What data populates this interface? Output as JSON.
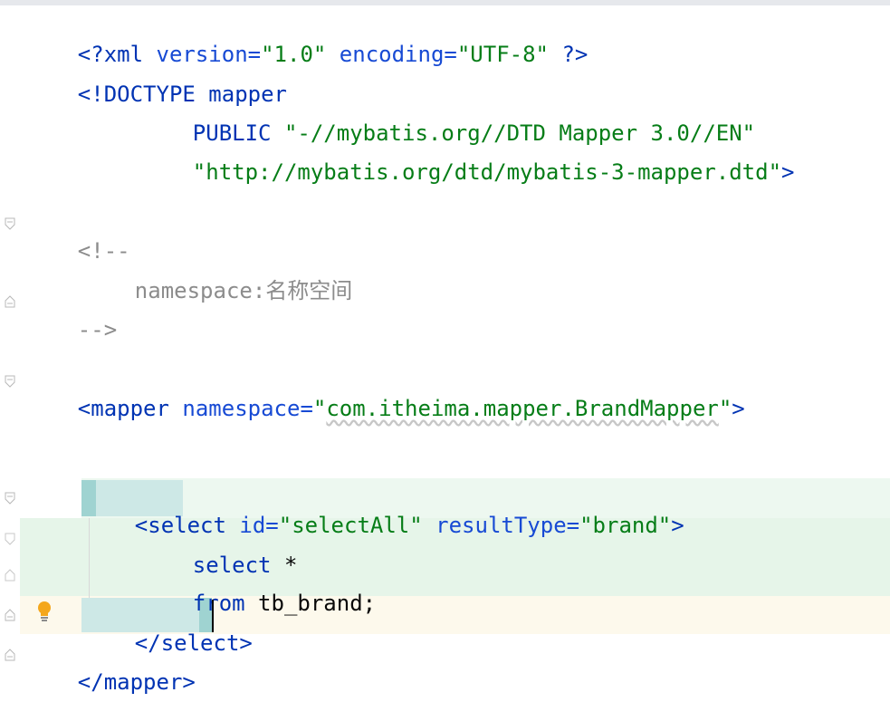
{
  "editor": {
    "language": "xml",
    "lines": {
      "l1": {
        "open": "<?",
        "name": "xml",
        "attr1": " version=",
        "val1": "\"1.0\"",
        "attr2": " encoding=",
        "val2": "\"UTF-8\"",
        "close": " ?>"
      },
      "l2": {
        "text": "<!DOCTYPE mapper"
      },
      "l3": {
        "kw": "PUBLIC",
        "val": " \"-//mybatis.org//DTD Mapper 3.0//EN\""
      },
      "l4": {
        "val": "\"http://mybatis.org/dtd/mybatis-3-mapper.dtd\"",
        "close": ">"
      },
      "l5": {
        "text": "<!--"
      },
      "l6": {
        "prefix": "namespace:",
        "cjk": "名称空间"
      },
      "l7": {
        "text": "-->"
      },
      "l8": {
        "open": "<",
        "tag": "mapper",
        "attr": " namespace=",
        "val_q1": "\"",
        "val": "com.itheima.mapper.BrandMapper",
        "val_q2": "\"",
        "close": ">"
      },
      "l9": {
        "open": "<",
        "tag": "select",
        "attr1": " id=",
        "val1": "\"selectAll\"",
        "attr2": " resultType=",
        "val2": "\"brand\"",
        "close": ">"
      },
      "l10": {
        "kw": "select",
        "rest": " *"
      },
      "l11": {
        "kw": "from",
        "rest": " tb_brand;"
      },
      "l12": {
        "open": "</",
        "tag": "select",
        "close": ">"
      },
      "l13": {
        "open": "</",
        "tag": "mapper",
        "close": ">"
      }
    },
    "icons": {
      "fold": "fold-marker-icon",
      "intention": "lightbulb-icon"
    },
    "colors": {
      "tag": "#0033b3",
      "attribute": "#174ad4",
      "value": "#067d17",
      "comment": "#8c8c8c",
      "highlight_green": "#e6f5e9",
      "caret_line": "#fdf9ec",
      "tag_match": "#9fd3d1"
    }
  }
}
